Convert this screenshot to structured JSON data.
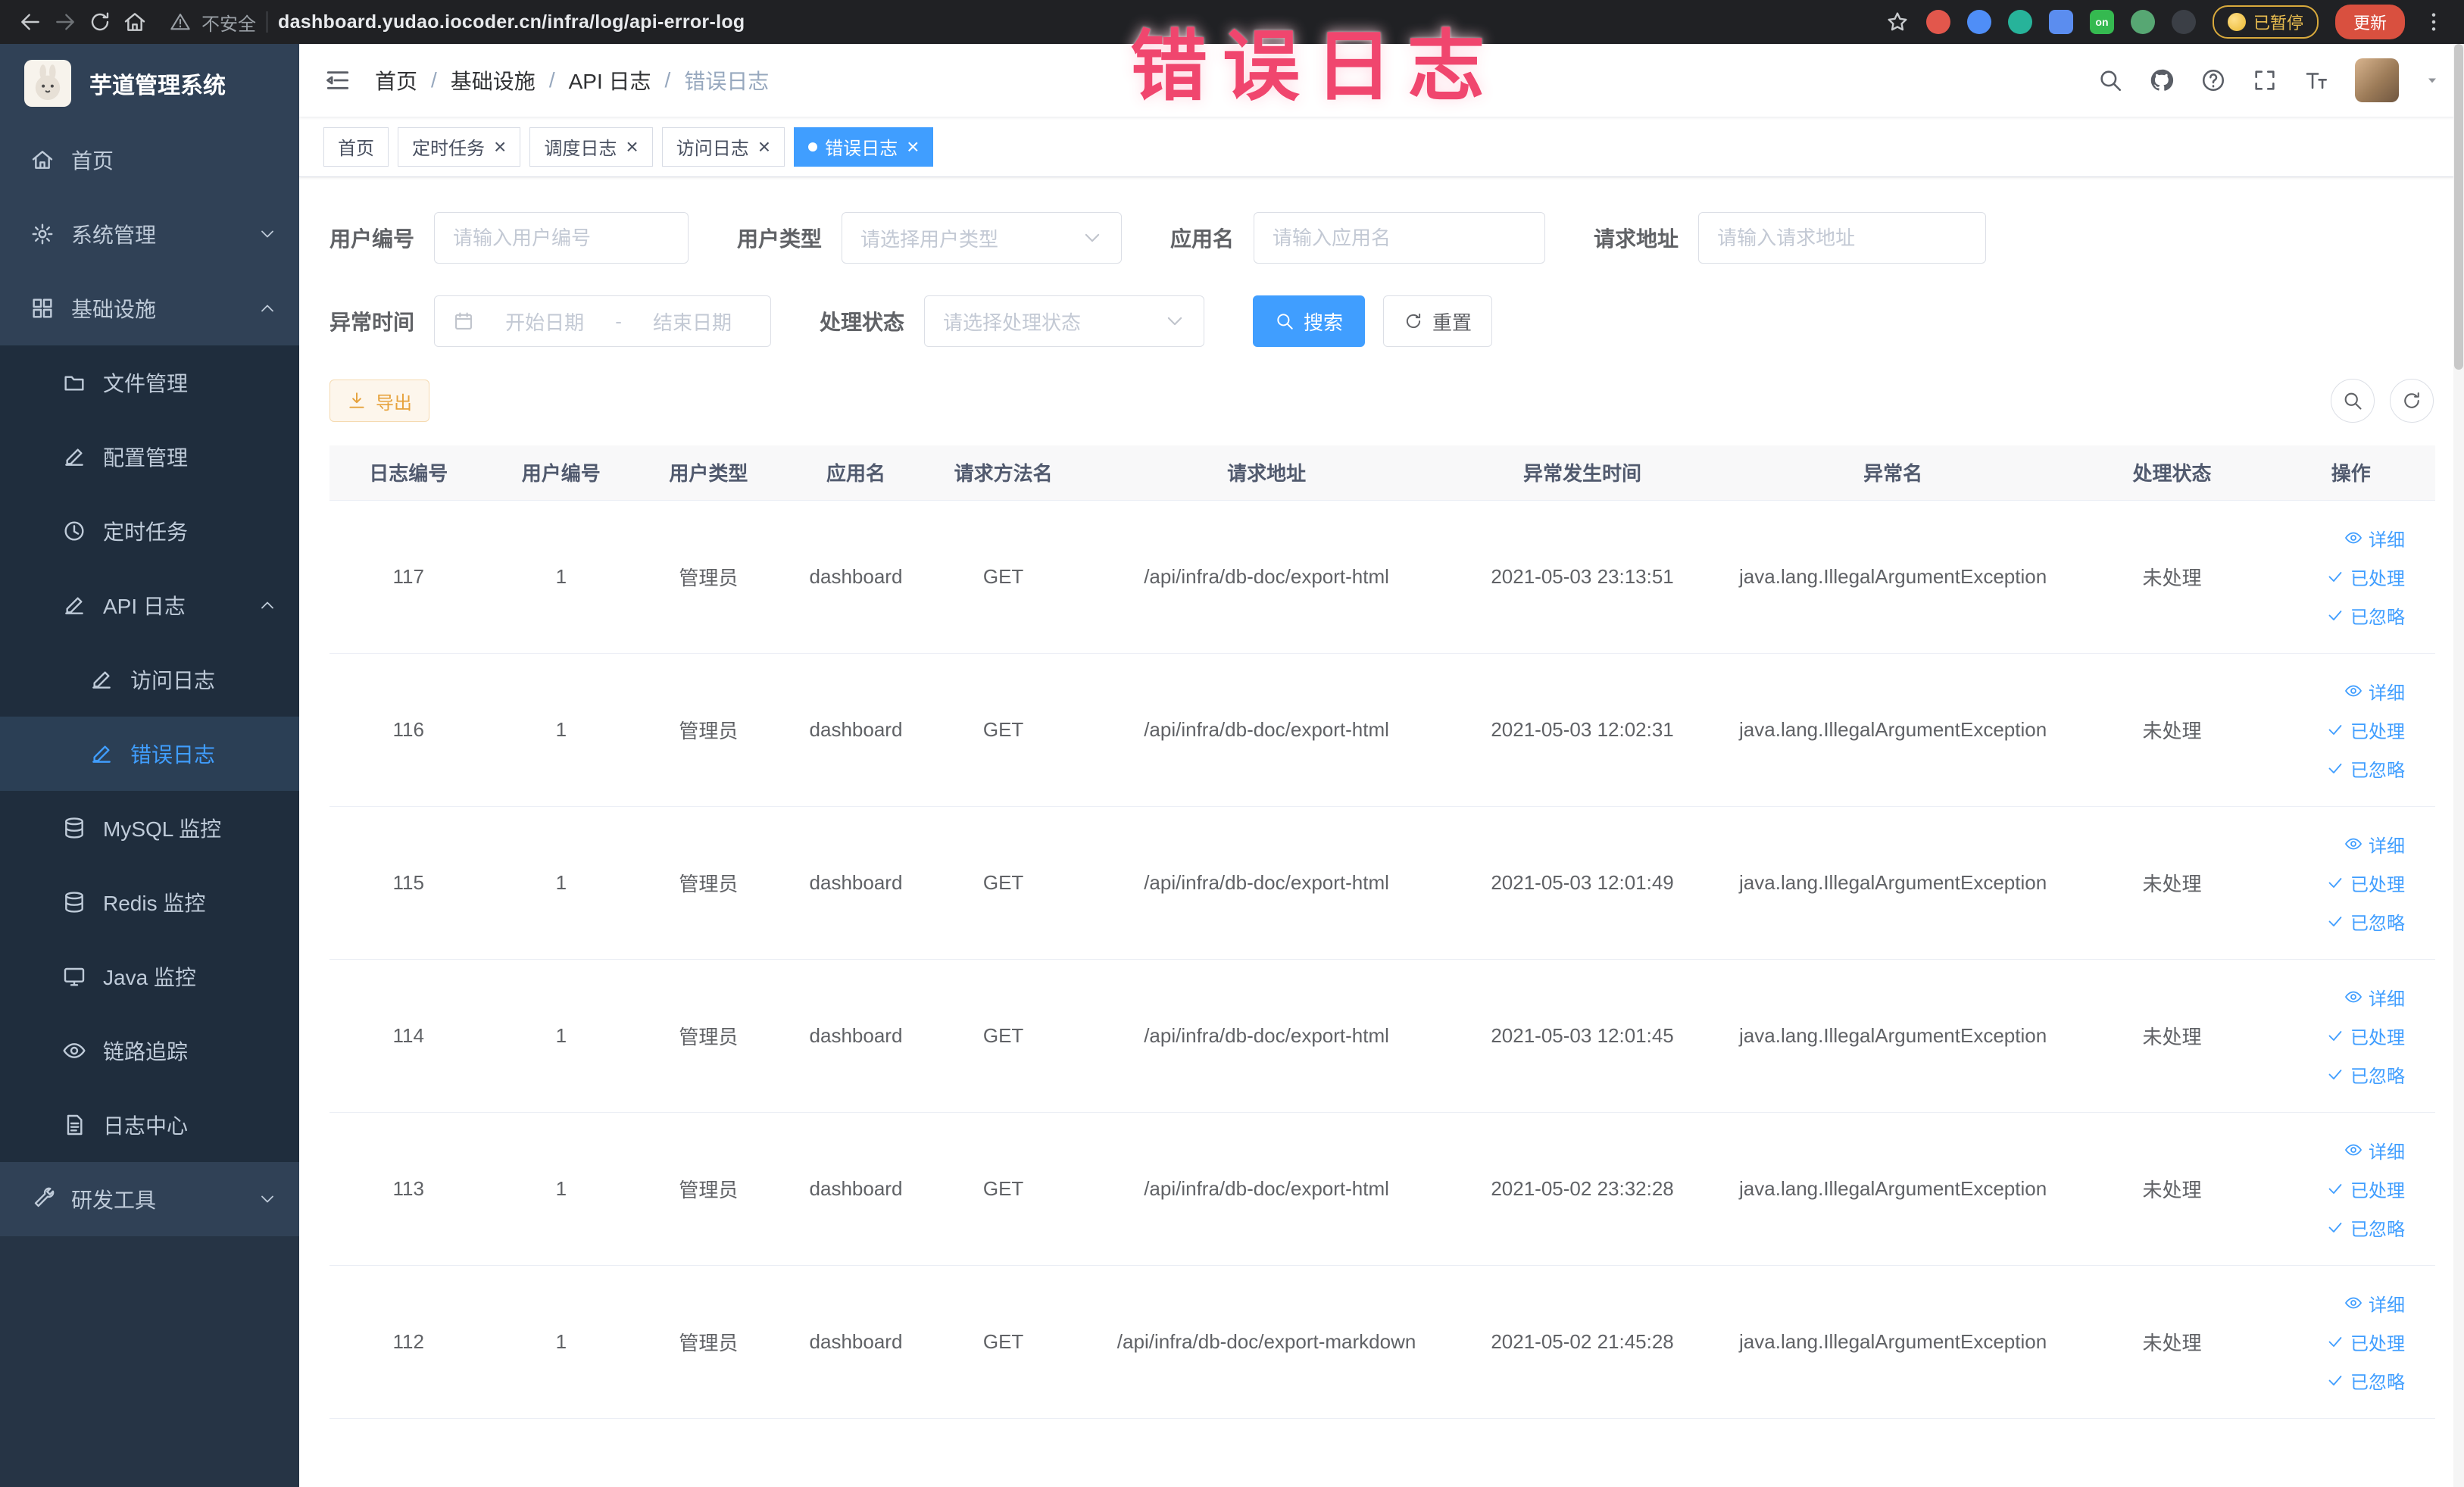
{
  "browser": {
    "security_label": "不安全",
    "url": "dashboard.yudao.iocoder.cn/infra/log/api-error-log",
    "extension_on_label": "on",
    "paused_badge": "已暂停",
    "update_button": "更新"
  },
  "annotation": "错误日志",
  "colors": {
    "primary": "#409EFF",
    "sidebar_bg": "#304156",
    "submenu_bg": "#1F2D3D",
    "warning": "#E6A23C",
    "annotation_pink": "#F0466E"
  },
  "sidebar": {
    "logo_title": "芋道管理系统",
    "menu": [
      {
        "id": "home",
        "label": "首页",
        "icon": "home",
        "level": 1
      },
      {
        "id": "system-management",
        "label": "系统管理",
        "icon": "gear",
        "level": 1,
        "arrow": "down"
      },
      {
        "id": "infrastructure",
        "label": "基础设施",
        "icon": "grid",
        "level": 1,
        "arrow": "up"
      },
      {
        "id": "file-management",
        "label": "文件管理",
        "icon": "folder",
        "level": 2
      },
      {
        "id": "config-management",
        "label": "配置管理",
        "icon": "edit",
        "level": 2
      },
      {
        "id": "scheduled-jobs",
        "label": "定时任务",
        "icon": "clock",
        "level": 2
      },
      {
        "id": "api-log",
        "label": "API 日志",
        "icon": "edit",
        "level": 2,
        "arrow": "up"
      },
      {
        "id": "access-log",
        "label": "访问日志",
        "icon": "edit",
        "level": 3
      },
      {
        "id": "error-log",
        "label": "错误日志",
        "icon": "edit",
        "level": 3,
        "active": true
      },
      {
        "id": "mysql-monitor",
        "label": "MySQL 监控",
        "icon": "db",
        "level": 2
      },
      {
        "id": "redis-monitor",
        "label": "Redis 监控",
        "icon": "db",
        "level": 2
      },
      {
        "id": "java-monitor",
        "label": "Java 监控",
        "icon": "monitor",
        "level": 2
      },
      {
        "id": "trace",
        "label": "链路追踪",
        "icon": "eye",
        "level": 2
      },
      {
        "id": "log-center",
        "label": "日志中心",
        "icon": "doc",
        "level": 2
      },
      {
        "id": "dev-tools",
        "label": "研发工具",
        "icon": "tool",
        "level": 1,
        "arrow": "down"
      }
    ]
  },
  "header": {
    "breadcrumb": [
      "首页",
      "基础设施",
      "API 日志",
      "错误日志"
    ],
    "separator": "/"
  },
  "tabs_ui": {
    "close_glyph": "×"
  },
  "tabs": [
    {
      "id": "home",
      "label": "首页",
      "closable": false,
      "active": false
    },
    {
      "id": "scheduled-jobs",
      "label": "定时任务",
      "closable": true,
      "active": false
    },
    {
      "id": "job-log",
      "label": "调度日志",
      "closable": true,
      "active": false
    },
    {
      "id": "access-log",
      "label": "访问日志",
      "closable": true,
      "active": false
    },
    {
      "id": "error-log",
      "label": "错误日志",
      "closable": true,
      "active": true
    }
  ],
  "filters": {
    "user_id_label": "用户编号",
    "user_id_placeholder": "请输入用户编号",
    "user_type_label": "用户类型",
    "user_type_placeholder": "请选择用户类型",
    "app_name_label": "应用名",
    "app_name_placeholder": "请输入应用名",
    "request_url_label": "请求地址",
    "request_url_placeholder": "请输入请求地址",
    "exception_time_label": "异常时间",
    "date_start_placeholder": "开始日期",
    "date_separator": "-",
    "date_end_placeholder": "结束日期",
    "process_status_label": "处理状态",
    "process_status_placeholder": "请选择处理状态",
    "search_button": "搜索",
    "reset_button": "重置"
  },
  "toolbar": {
    "export_label": "导出"
  },
  "table": {
    "columns": [
      "日志编号",
      "用户编号",
      "用户类型",
      "应用名",
      "请求方法名",
      "请求地址",
      "异常发生时间",
      "异常名",
      "处理状态",
      "操作"
    ],
    "action_labels": {
      "detail": "详细",
      "processed": "已处理",
      "ignored": "已忽略"
    },
    "rows": [
      {
        "id": "117",
        "user_id": "1",
        "user_type": "管理员",
        "app": "dashboard",
        "method": "GET",
        "url": "/api/infra/db-doc/export-html",
        "time": "2021-05-03 23:13:51",
        "exception": "java.lang.IllegalArgumentException",
        "status": "未处理"
      },
      {
        "id": "116",
        "user_id": "1",
        "user_type": "管理员",
        "app": "dashboard",
        "method": "GET",
        "url": "/api/infra/db-doc/export-html",
        "time": "2021-05-03 12:02:31",
        "exception": "java.lang.IllegalArgumentException",
        "status": "未处理"
      },
      {
        "id": "115",
        "user_id": "1",
        "user_type": "管理员",
        "app": "dashboard",
        "method": "GET",
        "url": "/api/infra/db-doc/export-html",
        "time": "2021-05-03 12:01:49",
        "exception": "java.lang.IllegalArgumentException",
        "status": "未处理"
      },
      {
        "id": "114",
        "user_id": "1",
        "user_type": "管理员",
        "app": "dashboard",
        "method": "GET",
        "url": "/api/infra/db-doc/export-html",
        "time": "2021-05-03 12:01:45",
        "exception": "java.lang.IllegalArgumentException",
        "status": "未处理"
      },
      {
        "id": "113",
        "user_id": "1",
        "user_type": "管理员",
        "app": "dashboard",
        "method": "GET",
        "url": "/api/infra/db-doc/export-html",
        "time": "2021-05-02 23:32:28",
        "exception": "java.lang.IllegalArgumentException",
        "status": "未处理"
      },
      {
        "id": "112",
        "user_id": "1",
        "user_type": "管理员",
        "app": "dashboard",
        "method": "GET",
        "url": "/api/infra/db-doc/export-markdown",
        "time": "2021-05-02 21:45:28",
        "exception": "java.lang.IllegalArgumentException",
        "status": "未处理"
      }
    ]
  }
}
